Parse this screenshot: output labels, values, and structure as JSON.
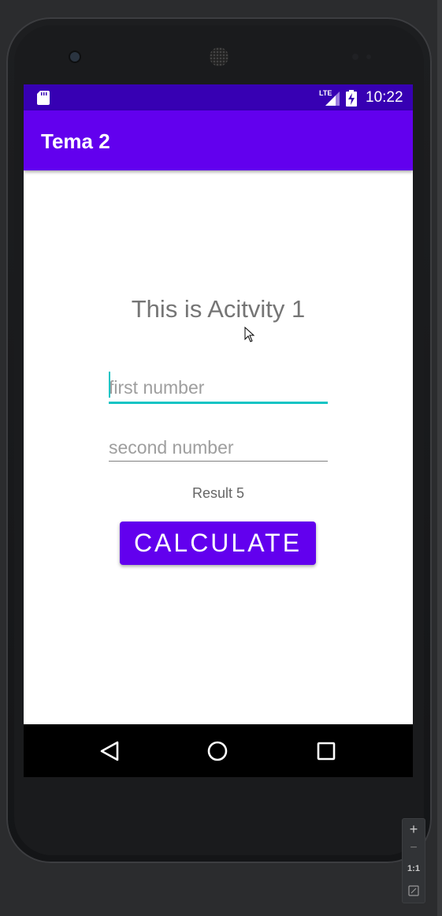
{
  "status_bar": {
    "network": "LTE",
    "time": "10:22"
  },
  "app_bar": {
    "title": "Tema 2"
  },
  "content": {
    "heading": "This is Acitvity 1",
    "first_number": {
      "placeholder": "first number",
      "value": ""
    },
    "second_number": {
      "placeholder": "second number",
      "value": ""
    },
    "result": "Result 5",
    "calculate_label": "CALCULATE"
  },
  "zoom_controls": {
    "zoom_in": "+",
    "zoom_out": "−",
    "actual_size": "1:1"
  },
  "colors": {
    "status_bar": "#3700b3",
    "primary": "#6200ee",
    "focus_accent": "#12c4c4",
    "navigation_bar": "#000000",
    "emulator_frame": "#1a1b1d"
  }
}
